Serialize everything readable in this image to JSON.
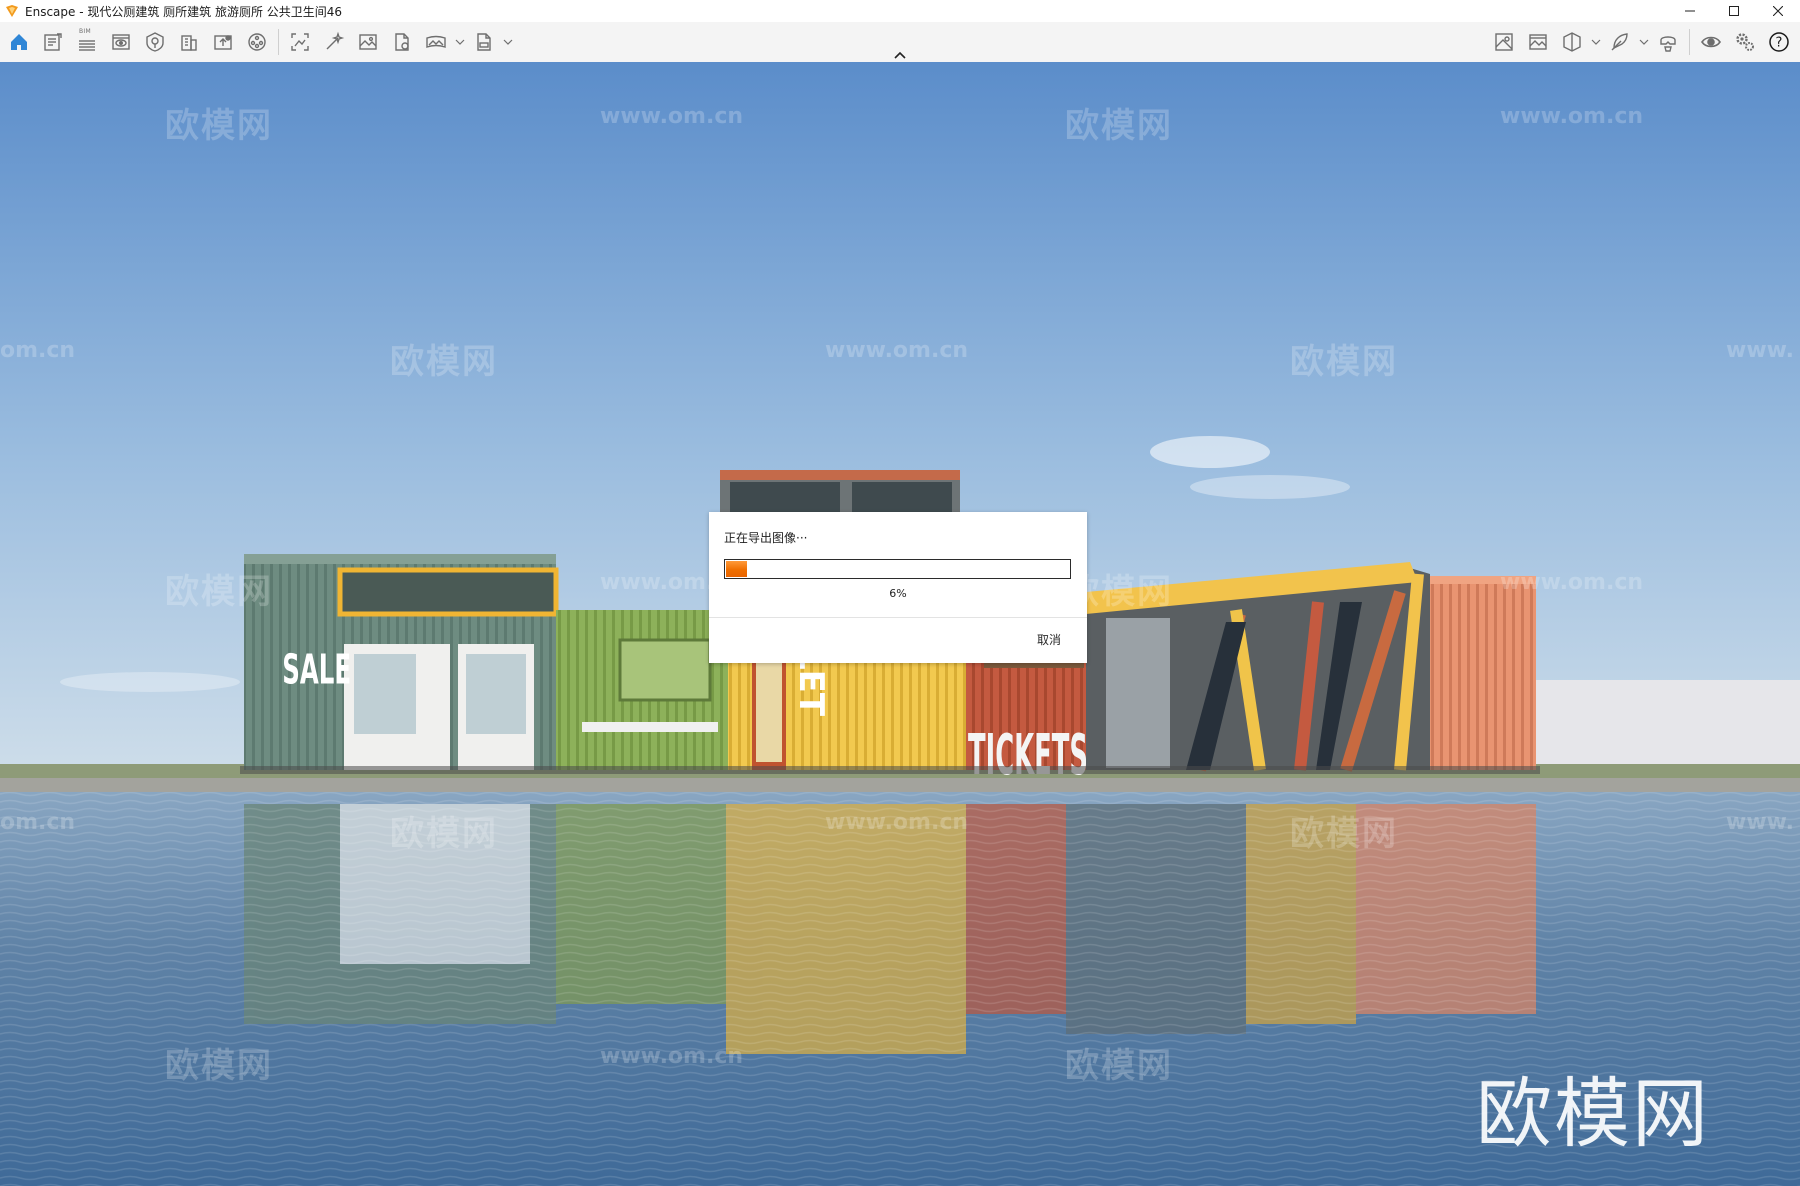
{
  "window": {
    "title": "Enscape - 现代公厕建筑 厕所建筑 旅游厕所 公共卫生间46",
    "controls": [
      "minimize",
      "maximize",
      "close"
    ]
  },
  "toolbar": {
    "left_icons": [
      "home-icon",
      "document-icon",
      "bim-icon",
      "view-icon",
      "visual-settings-icon",
      "building-icon",
      "upload-icon",
      "asset-library-icon",
      "screenshot-icon",
      "magic-icon",
      "image-icon",
      "file-icon",
      "panorama-icon",
      "export-icon"
    ],
    "bim_label": "BIM",
    "right_icons": [
      "map-icon",
      "gallery-icon",
      "section-icon",
      "feather-icon",
      "vr-headset-icon",
      "eye-icon",
      "settings-icon",
      "help-icon"
    ]
  },
  "dialog": {
    "title": "正在导出图像···",
    "progress_value": 0.06,
    "progress_text": "6%",
    "cancel_label": "取消"
  },
  "scene": {
    "signs": {
      "sale": "SALE",
      "toilet": "LET",
      "tickets": "TICKETS"
    },
    "watermarks": {
      "cn": "欧模网",
      "url": "www.om.cn",
      "url_partial_left": "om.cn",
      "url_partial_right": "www.",
      "big": "欧模网"
    },
    "colors": {
      "sky_top": "#5e8fcb",
      "sky_bottom": "#c9dbea",
      "water": "#5d7fa0",
      "container_green": "#6f8d82",
      "container_lime": "#8fb35c",
      "container_yellow": "#f0c64a",
      "container_red": "#c0573f",
      "container_orange": "#e78d6b"
    }
  }
}
